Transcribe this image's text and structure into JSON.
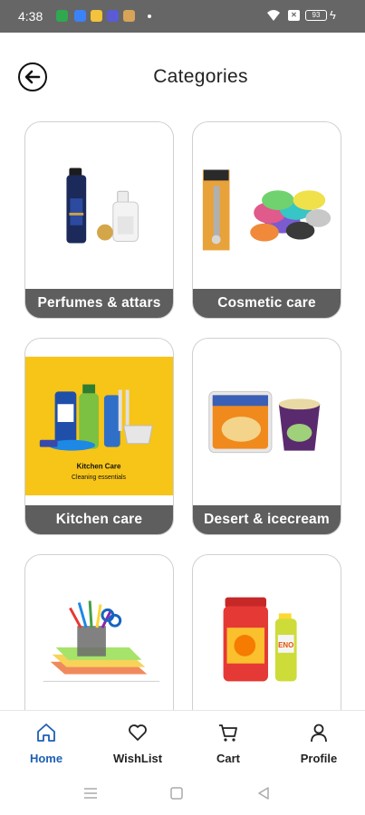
{
  "status_bar": {
    "time": "4:38",
    "battery": "93",
    "notification_icons": [
      "call-icon",
      "messages-icon",
      "app-icon",
      "chat-icon",
      "package-icon"
    ]
  },
  "header": {
    "title": "Categories",
    "back_icon": "back-arrow-icon"
  },
  "categories": [
    {
      "label": "Perfumes & attars",
      "image": "perfume-bottles-image"
    },
    {
      "label": "Cosmetic care",
      "image": "hair-ties-image"
    },
    {
      "label": "Kitchen care",
      "image": "kitchen-cleaning-products-image",
      "image_text": {
        "title": "Kitchen Care",
        "subtitle": "Cleaning essentials"
      }
    },
    {
      "label": "Desert & icecream",
      "image": "ice-cream-tubs-image"
    },
    {
      "label": "",
      "image": "stationery-image"
    },
    {
      "label": "",
      "image": "health-products-image"
    }
  ],
  "bottom_nav": {
    "items": [
      {
        "label": "Home",
        "icon": "home-icon",
        "active": true
      },
      {
        "label": "WishList",
        "icon": "heart-icon",
        "active": false
      },
      {
        "label": "Cart",
        "icon": "cart-icon",
        "active": false
      },
      {
        "label": "Profile",
        "icon": "person-icon",
        "active": false
      }
    ]
  },
  "system_nav": [
    "recents-icon",
    "home-square-icon",
    "back-triangle-icon"
  ],
  "colors": {
    "status_bar": "#666666",
    "label_bg": "#5e5e5e",
    "active_nav": "#1e5fb4",
    "kitchen_bg": "#f7c418"
  }
}
